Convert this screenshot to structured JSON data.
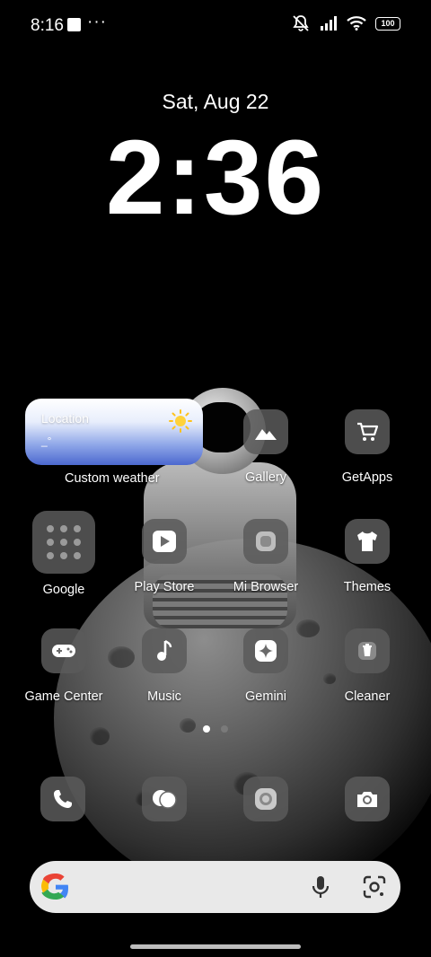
{
  "status_bar": {
    "time": "8:16",
    "dots": "···",
    "battery": "100"
  },
  "lockclock": {
    "date": "Sat, Aug 22",
    "time": "2:36"
  },
  "weather_widget": {
    "location": "Location",
    "temperature": "_°",
    "label": "Custom weather"
  },
  "apps": [
    {
      "label": "Gallery",
      "icon": "mountain-icon"
    },
    {
      "label": "GetApps",
      "icon": "cart-icon"
    },
    {
      "label": "Google",
      "icon": "folder-grid-icon"
    },
    {
      "label": "Play Store",
      "icon": "play-icon"
    },
    {
      "label": "Mi Browser",
      "icon": "browser-icon"
    },
    {
      "label": "Themes",
      "icon": "shirt-icon"
    },
    {
      "label": "Game Center",
      "icon": "gamepad-icon"
    },
    {
      "label": "Music",
      "icon": "music-note-icon"
    },
    {
      "label": "Gemini",
      "icon": "sparkle-icon"
    },
    {
      "label": "Cleaner",
      "icon": "trash-icon"
    }
  ],
  "dock": [
    {
      "icon": "phone-icon"
    },
    {
      "icon": "messages-icon"
    },
    {
      "icon": "camera-lens-icon"
    },
    {
      "icon": "camera-icon"
    }
  ],
  "pager": {
    "pages": 2,
    "active": 1
  },
  "colors": {
    "icon_bg": "#5a5a5a",
    "search_bg": "#e9e9e9",
    "weather_blue": "#4b68cf"
  }
}
